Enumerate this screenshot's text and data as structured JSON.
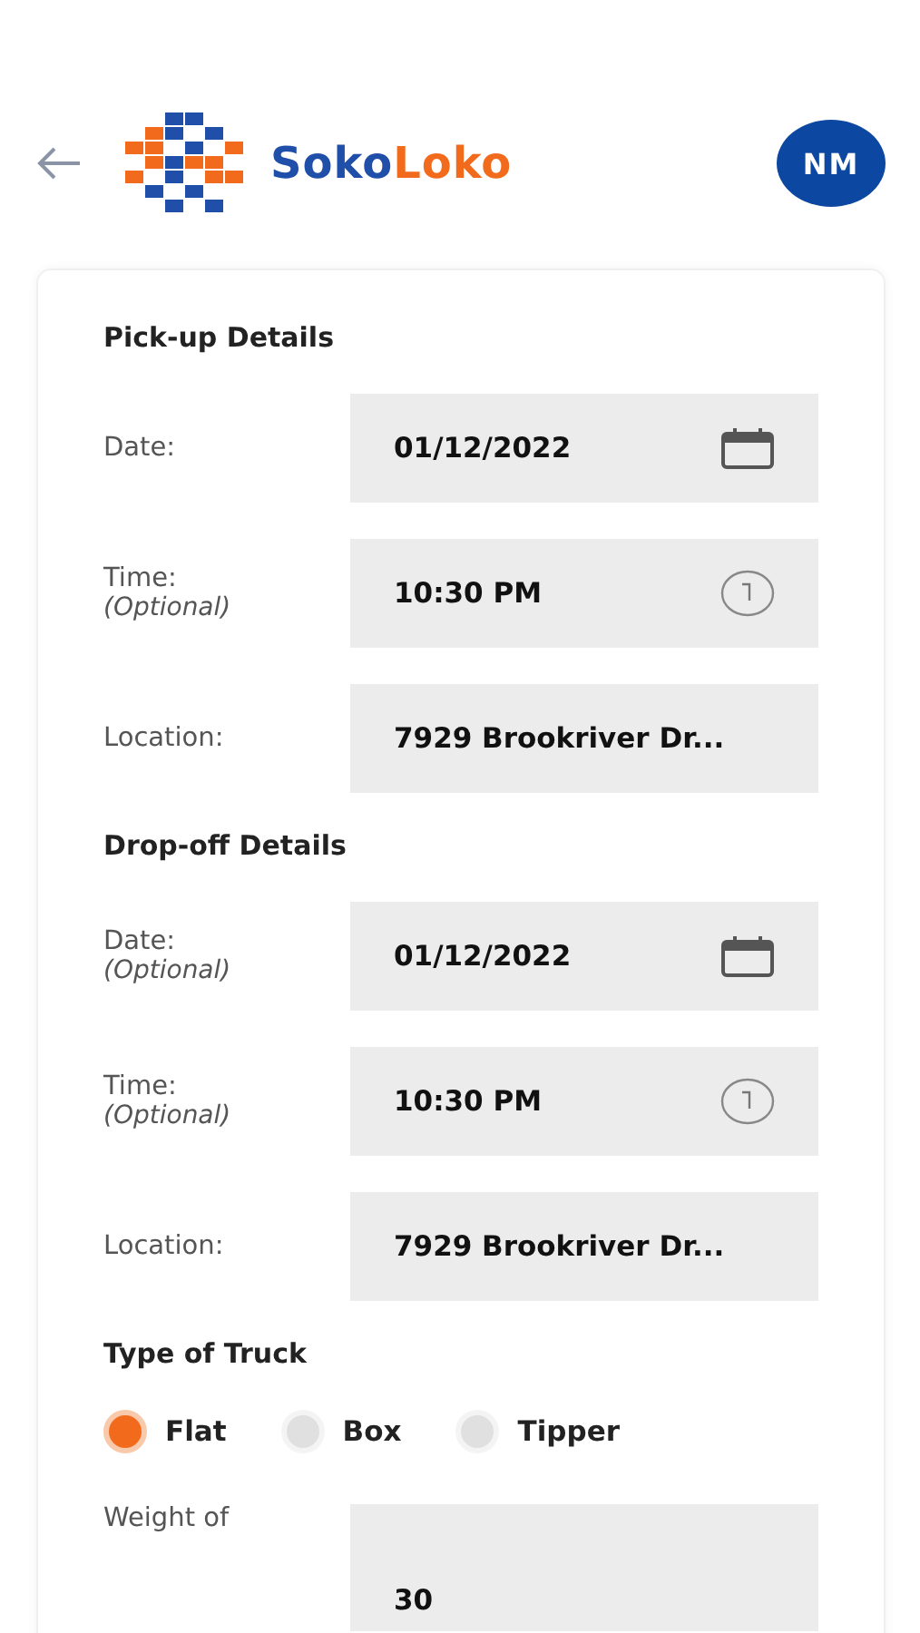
{
  "header": {
    "brand_first": "Soko",
    "brand_second": "Loko",
    "avatar": "NM"
  },
  "sections": [
    {
      "title": "Pick-up Details",
      "fields": [
        {
          "label": "Date:",
          "value": "01/12/2022",
          "kind": "date"
        },
        {
          "label": "Time:",
          "optional": "(Optional)",
          "value": "10:30 PM",
          "kind": "time"
        },
        {
          "label": "Location:",
          "value": "7929 Brookriver Dr...",
          "kind": "text"
        }
      ]
    },
    {
      "title": "Drop-off Details",
      "fields": [
        {
          "label": "Date:",
          "optional": "(Optional)",
          "value": "01/12/2022",
          "kind": "date"
        },
        {
          "label": "Time:",
          "optional": "(Optional)",
          "value": "10:30 PM",
          "kind": "time"
        },
        {
          "label": "Location:",
          "value": "7929 Brookriver Dr...",
          "kind": "text"
        }
      ]
    }
  ],
  "truck": {
    "title": "Type of Truck",
    "options": [
      {
        "label": "Flat",
        "selected": true
      },
      {
        "label": "Box",
        "selected": false
      },
      {
        "label": "Tipper",
        "selected": false
      }
    ]
  },
  "weight": {
    "label": "Weight of",
    "value": "30"
  }
}
